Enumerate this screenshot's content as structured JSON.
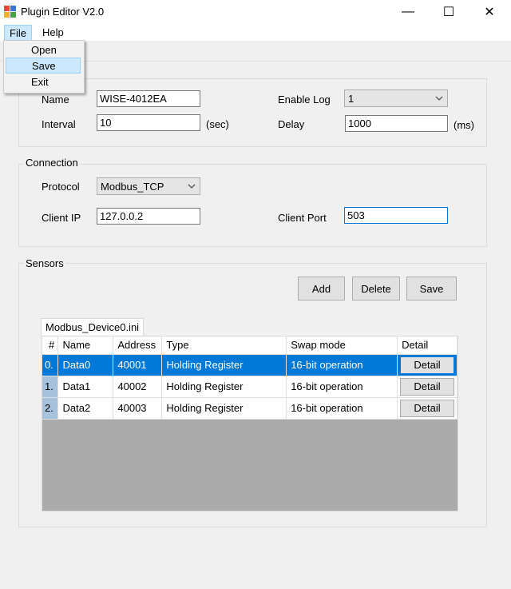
{
  "window": {
    "title": "Plugin Editor V2.0",
    "minimize": "—",
    "maximize": "☐",
    "close": "✕"
  },
  "menu": {
    "file": "File",
    "help": "Help"
  },
  "file_menu": {
    "items": [
      "Open",
      "Save",
      "Exit"
    ],
    "highlighted": "Save"
  },
  "general": {
    "name_label": "Name",
    "name_value": "WISE-4012EA",
    "interval_label": "Interval",
    "interval_value": "10",
    "interval_unit": "(sec)",
    "enable_log_label": "Enable Log",
    "enable_log_value": "1",
    "delay_label": "Delay",
    "delay_value": "1000",
    "delay_unit": "(ms)"
  },
  "connection": {
    "legend": "Connection",
    "protocol_label": "Protocol",
    "protocol_value": "Modbus_TCP",
    "client_ip_label": "Client IP",
    "client_ip_value": "127.0.0.2",
    "client_port_label": "Client Port",
    "client_port_value": "503"
  },
  "sensors": {
    "legend": "Sensors",
    "add": "Add",
    "delete": "Delete",
    "save": "Save",
    "tab": "Modbus_Device0.ini",
    "columns": [
      "#",
      "Name",
      "Address",
      "Type",
      "Swap mode",
      "Detail"
    ],
    "rows": [
      {
        "index": "0.",
        "name": "Data0",
        "address": "40001",
        "type": "Holding Register",
        "swap": "16-bit operation",
        "detail": "Detail"
      },
      {
        "index": "1.",
        "name": "Data1",
        "address": "40002",
        "type": "Holding Register",
        "swap": "16-bit operation",
        "detail": "Detail"
      },
      {
        "index": "2.",
        "name": "Data2",
        "address": "40003",
        "type": "Holding Register",
        "swap": "16-bit operation",
        "detail": "Detail"
      }
    ]
  },
  "colors": {
    "selection": "#0078d7",
    "menu_highlight": "#cce8ff",
    "row_header": "#a6c1db",
    "grid_background": "#ababab"
  },
  "icons": [
    "app-icon",
    "chevron-down-icon"
  ]
}
